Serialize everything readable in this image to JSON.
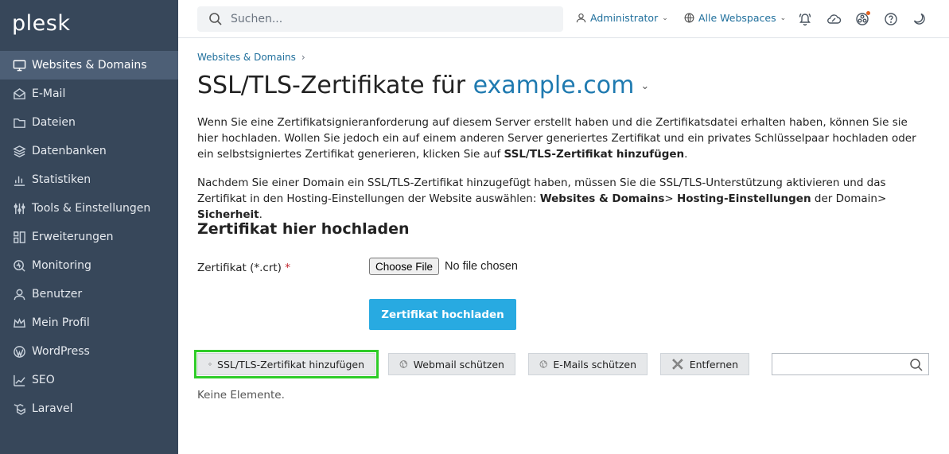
{
  "brand": "plesk",
  "sidebar": {
    "items": [
      {
        "label": "Websites & Domains",
        "icon": "monitor-icon",
        "active": true
      },
      {
        "label": "E-Mail",
        "icon": "mail-icon"
      },
      {
        "label": "Dateien",
        "icon": "folder-icon"
      },
      {
        "label": "Datenbanken",
        "icon": "database-icon"
      },
      {
        "label": "Statistiken",
        "icon": "bar-chart-icon"
      },
      {
        "label": "Tools & Einstellungen",
        "icon": "sliders-icon"
      },
      {
        "label": "Erweiterungen",
        "icon": "extensions-icon"
      },
      {
        "label": "Monitoring",
        "icon": "monitoring-icon"
      },
      {
        "label": "Benutzer",
        "icon": "user-icon"
      },
      {
        "label": "Mein Profil",
        "icon": "profile-crown-icon"
      },
      {
        "label": "WordPress",
        "icon": "wordpress-icon"
      },
      {
        "label": "SEO",
        "icon": "seo-icon"
      },
      {
        "label": "Laravel",
        "icon": "laravel-icon"
      }
    ]
  },
  "topbar": {
    "search_placeholder": "Suchen...",
    "user_label": "Administrator",
    "webspaces_label": "Alle Webspaces"
  },
  "breadcrumb": {
    "item": "Websites & Domains"
  },
  "page": {
    "title_prefix": "SSL/TLS-Zertifikate für",
    "domain": "example.com",
    "p1_text": "Wenn Sie eine Zertifikatsignieranforderung auf diesem Server erstellt haben und die Zertifikatsdatei erhalten haben, können Sie sie hier hochladen. Wollen Sie jedoch ein auf einem anderen Server generiertes Zertifikat und ein privates Schlüsselpaar hochladen oder ein selbstsigniertes Zertifikat generieren, klicken Sie auf ",
    "p1_bold": "SSL/TLS-Zertifikat hinzufügen",
    "p1_end": ".",
    "p2_text": "Nachdem Sie einer Domain ein SSL/TLS-Zertifikat hinzugefügt haben, müssen Sie die SSL/TLS-Unterstützung aktivieren und das Zertifikat in den Hosting-Einstellungen der Website auswählen: ",
    "p2_bold1": "Websites & Domains",
    "p2_mid1": "> ",
    "p2_bold2": "Hosting-Einstellungen",
    "p2_mid2": " der Domain> ",
    "p2_bold3": "Sicherheit",
    "p2_end": ".",
    "section_title": "Zertifikat hier hochladen",
    "field_label": "Zertifikat (*.crt)",
    "required_mark": "*",
    "choose_file": "Choose File",
    "no_file": "No file chosen",
    "upload_button": "Zertifikat hochladen"
  },
  "toolbar": {
    "add": "SSL/TLS-Zertifikat hinzufügen",
    "webmail": "Webmail schützen",
    "emails": "E-Mails schützen",
    "remove": "Entfernen"
  },
  "list": {
    "empty": "Keine Elemente."
  },
  "colors": {
    "sidebar_bg": "#37475a",
    "active_item": "#4d5f76",
    "accent": "#28aae1",
    "link": "#1f6f9c",
    "highlight": "#2ecc28"
  }
}
